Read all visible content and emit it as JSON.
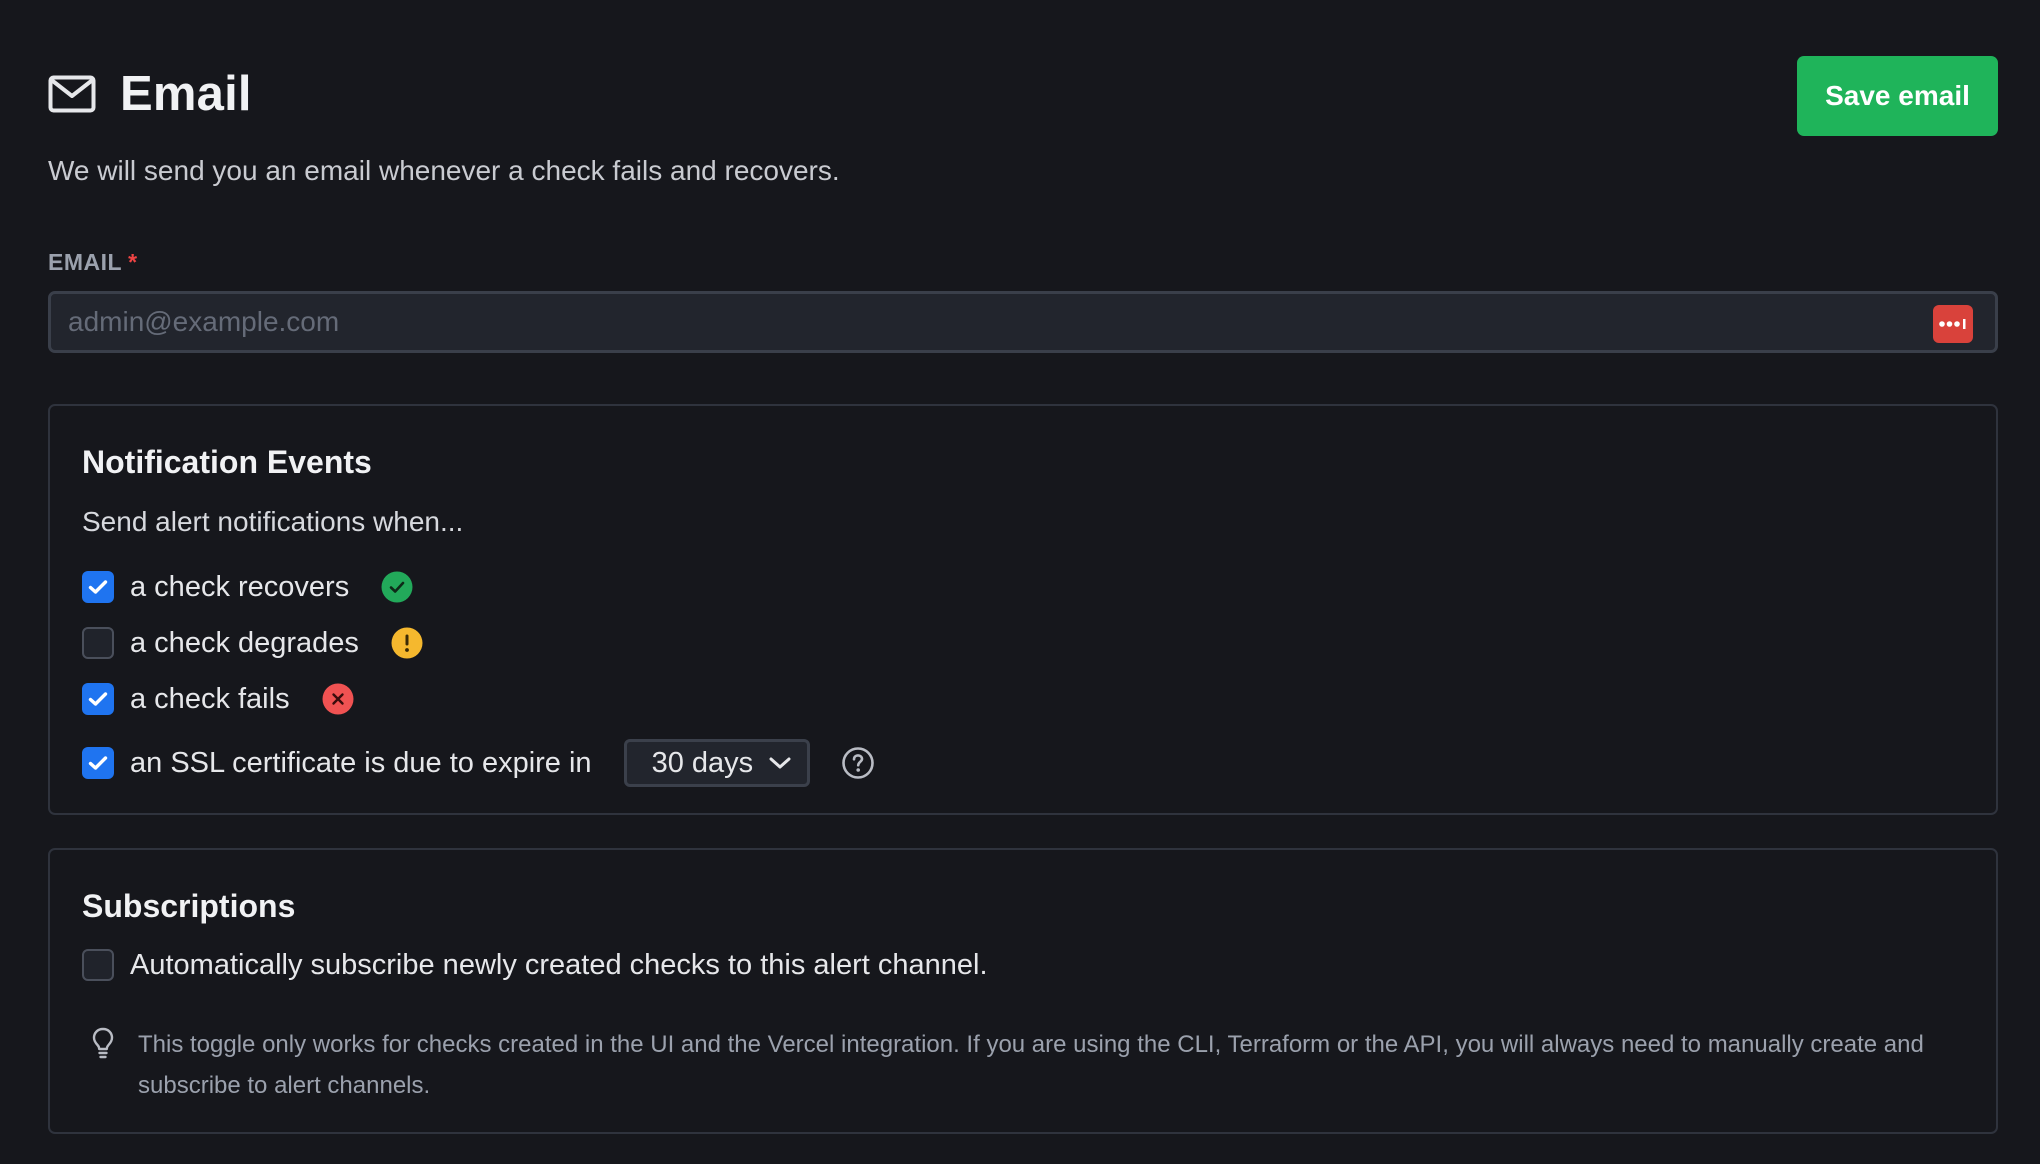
{
  "header": {
    "icon": "mail-icon",
    "title": "Email",
    "subtitle": "We will send you an email whenever a check fails and recovers.",
    "save_label": "Save email"
  },
  "email_field": {
    "label": "EMAIL",
    "required_mark": "*",
    "placeholder": "admin@example.com",
    "value": "",
    "badge_icon": "password-manager-icon"
  },
  "events": {
    "title": "Notification Events",
    "intro": "Send alert notifications when...",
    "items": [
      {
        "label": "a check recovers",
        "checked": true,
        "status_icon": "check-circle-icon",
        "status_color": "#22a95a"
      },
      {
        "label": "a check degrades",
        "checked": false,
        "status_icon": "warning-circle-icon",
        "status_color": "#f5b82e"
      },
      {
        "label": "a check fails",
        "checked": true,
        "status_icon": "x-circle-icon",
        "status_color": "#f05252"
      },
      {
        "label": "an SSL certificate is due to expire in",
        "checked": true
      }
    ],
    "ssl_select": {
      "value": "30 days"
    },
    "help_icon": "question-circle-icon"
  },
  "subscriptions": {
    "title": "Subscriptions",
    "auto_subscribe": {
      "label": "Automatically subscribe newly created checks to this alert channel.",
      "checked": false
    },
    "tip_icon": "lightbulb-icon",
    "tip": "This toggle only works for checks created in the UI and the Vercel integration. If you are using the CLI, Terraform or the API, you will always need to manually create and subscribe to alert channels."
  },
  "colors": {
    "background": "#16171c",
    "accent_green": "#1fb45a",
    "checkbox_blue": "#1f74f0",
    "required_red": "#ef4444"
  }
}
